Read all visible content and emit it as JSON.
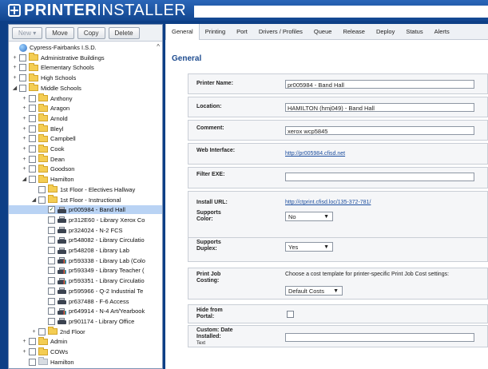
{
  "header": {
    "logo_bold": "PRINTER",
    "logo_light": "INSTALLER"
  },
  "toolbar": {
    "new_label": "New ▾",
    "move_label": "Move",
    "copy_label": "Copy",
    "delete_label": "Delete"
  },
  "tree": {
    "nodes": [
      {
        "label": "Cypress-Fairbanks I.S.D.",
        "kind": "globe",
        "checkbox": false,
        "expander": ""
      },
      {
        "label": "Administrative Buildings",
        "kind": "folder",
        "checkbox": true,
        "expander": "+"
      },
      {
        "label": "Elementary Schools",
        "kind": "folder",
        "checkbox": true,
        "expander": "+"
      },
      {
        "label": "High Schools",
        "kind": "folder",
        "checkbox": true,
        "expander": "+"
      },
      {
        "label": "Middle Schools",
        "kind": "folder",
        "checkbox": true,
        "expander": "◢"
      },
      {
        "label": "Anthony",
        "kind": "folder",
        "checkbox": true,
        "expander": "+"
      },
      {
        "label": "Aragon",
        "kind": "folder",
        "checkbox": true,
        "expander": "+"
      },
      {
        "label": "Arnold",
        "kind": "folder",
        "checkbox": true,
        "expander": "+"
      },
      {
        "label": "Bleyl",
        "kind": "folder",
        "checkbox": true,
        "expander": "+"
      },
      {
        "label": "Campbell",
        "kind": "folder",
        "checkbox": true,
        "expander": "+"
      },
      {
        "label": "Cook",
        "kind": "folder",
        "checkbox": true,
        "expander": "+"
      },
      {
        "label": "Dean",
        "kind": "folder",
        "checkbox": true,
        "expander": "+"
      },
      {
        "label": "Goodson",
        "kind": "folder",
        "checkbox": true,
        "expander": "+"
      },
      {
        "label": "Hamilton",
        "kind": "folder",
        "checkbox": true,
        "expander": "◢"
      },
      {
        "label": "1st Floor - Electives Hallway",
        "kind": "folder",
        "checkbox": true,
        "expander": ""
      },
      {
        "label": "1st Floor - Instructional",
        "kind": "folder",
        "checkbox": true,
        "expander": "◢"
      },
      {
        "label": "pr005984 - Band Hall",
        "kind": "printer",
        "checkbox": true,
        "checked": true,
        "expander": "",
        "selected": true
      },
      {
        "label": "pr312E60 - Library Xerox Co",
        "kind": "printer",
        "checkbox": true,
        "expander": ""
      },
      {
        "label": "pr324024 - N-2 FCS",
        "kind": "printer",
        "checkbox": true,
        "expander": ""
      },
      {
        "label": "pr548082 - Library Circulatio",
        "kind": "printer",
        "checkbox": true,
        "expander": ""
      },
      {
        "label": "pr548208 - Library Lab",
        "kind": "printer",
        "checkbox": true,
        "expander": ""
      },
      {
        "label": "pr593338 - Library Lab (Colo",
        "kind": "printer-color",
        "checkbox": true,
        "expander": ""
      },
      {
        "label": "pr593349 - Library Teacher (",
        "kind": "printer-color",
        "checkbox": true,
        "expander": ""
      },
      {
        "label": "pr593351 - Library Circulatio",
        "kind": "printer-color",
        "checkbox": true,
        "expander": ""
      },
      {
        "label": "pr595966 - Q-2 Industrial Te",
        "kind": "printer",
        "checkbox": true,
        "expander": ""
      },
      {
        "label": "pr637488 - F-6 Access",
        "kind": "printer",
        "checkbox": true,
        "expander": ""
      },
      {
        "label": "pr649914 - N-4 Art/Yearbook",
        "kind": "printer-color",
        "checkbox": true,
        "expander": ""
      },
      {
        "label": "pr901174 - Library Office",
        "kind": "printer",
        "checkbox": true,
        "expander": ""
      },
      {
        "label": "2nd Floor",
        "kind": "folder",
        "checkbox": true,
        "expander": "+"
      },
      {
        "label": "Admin",
        "kind": "folder",
        "checkbox": true,
        "expander": "+"
      },
      {
        "label": "COWs",
        "kind": "folder",
        "checkbox": true,
        "expander": "+"
      },
      {
        "label": "Hamilton",
        "kind": "folder-grey",
        "checkbox": true,
        "expander": ""
      }
    ]
  },
  "tabs": [
    "General",
    "Printing",
    "Port",
    "Drivers / Profiles",
    "Queue",
    "Release",
    "Deploy",
    "Status",
    "Alerts"
  ],
  "general": {
    "title": "General",
    "printer_name_label": "Printer Name:",
    "printer_name_value": "pr005984 - Band Hall",
    "location_label": "Location:",
    "location_value": "HAMILTON (hmj049) - Band Hall",
    "comment_label": "Comment:",
    "comment_value": "xerox wcp5845",
    "web_interface_label": "Web Interface:",
    "web_interface_value": "http://pr005984.cfisd.net",
    "filter_exe_label": "Filter EXE:",
    "filter_exe_value": "",
    "install_url_label": "Install URL:",
    "install_url_value": "http://ctprint.cfisd.loc/135-372-781/",
    "supports_color_label": "Supports Color:",
    "supports_color_value": "No",
    "supports_duplex_label": "Supports Duplex:",
    "supports_duplex_value": "Yes",
    "print_job_costing_label": "Print Job Costing:",
    "print_job_costing_note": "Choose a cost template for printer-specific Print Job Cost settings:",
    "print_job_costing_value": "Default Costs",
    "hide_from_portal_label": "Hide from Portal:",
    "custom_label": "Custom: Date Installed:",
    "custom_sub": "Text",
    "custom_value": ""
  },
  "colors": {
    "header_bg": "#12468f",
    "page_bg": "#0d3f86",
    "link": "#1b4d9e",
    "selected_row": "#b9d3f4"
  }
}
